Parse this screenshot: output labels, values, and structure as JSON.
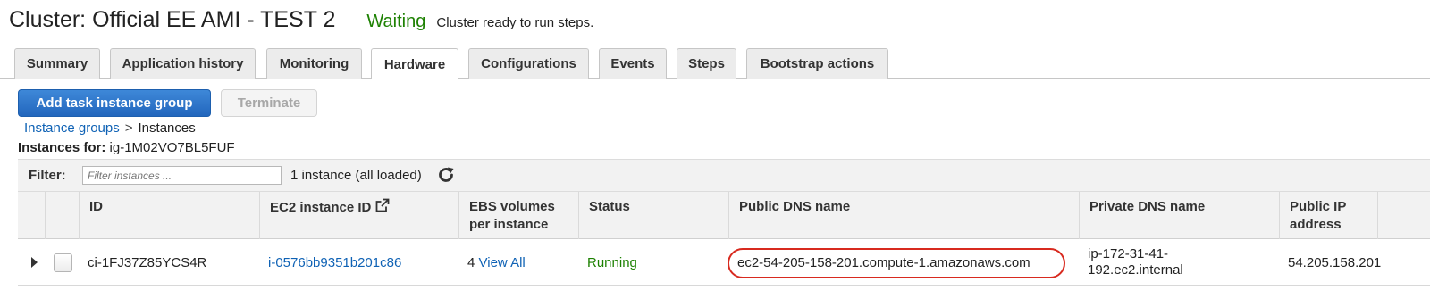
{
  "header": {
    "title": "Cluster: Official EE AMI - TEST 2",
    "status": "Waiting",
    "status_text": "Cluster ready to run steps."
  },
  "tabs": [
    {
      "label": "Summary",
      "active": false
    },
    {
      "label": "Application history",
      "active": false
    },
    {
      "label": "Monitoring",
      "active": false
    },
    {
      "label": "Hardware",
      "active": true
    },
    {
      "label": "Configurations",
      "active": false
    },
    {
      "label": "Events",
      "active": false
    },
    {
      "label": "Steps",
      "active": false
    },
    {
      "label": "Bootstrap actions",
      "active": false
    }
  ],
  "actions": {
    "add_task_group": "Add task instance group",
    "terminate": "Terminate"
  },
  "breadcrumb": {
    "parent": "Instance groups",
    "separator": ">",
    "current": "Instances"
  },
  "instances_for": {
    "label": "Instances for:",
    "value": "ig-1M02VO7BL5FUF"
  },
  "filter": {
    "label": "Filter:",
    "placeholder": "Filter instances ...",
    "count": "1 instance (all loaded)"
  },
  "table": {
    "columns": [
      "ID",
      "EC2 instance ID",
      "EBS volumes per instance",
      "Status",
      "Public DNS name",
      "Private DNS name",
      "Public IP address"
    ],
    "rows": [
      {
        "id": "ci-1FJ37Z85YCS4R",
        "ec2_instance_id": "i-0576bb9351b201c86",
        "ebs_count": "4",
        "ebs_link": "View All",
        "status": "Running",
        "public_dns": "ec2-54-205-158-201.compute-1.amazonaws.com",
        "private_dns": "ip-172-31-41-192.ec2.internal",
        "public_ip": "54.205.158.201"
      }
    ]
  },
  "colors": {
    "accent": "#2266bd",
    "link": "#0f62b5",
    "success": "#1d8102",
    "highlight": "#d82a1f"
  }
}
